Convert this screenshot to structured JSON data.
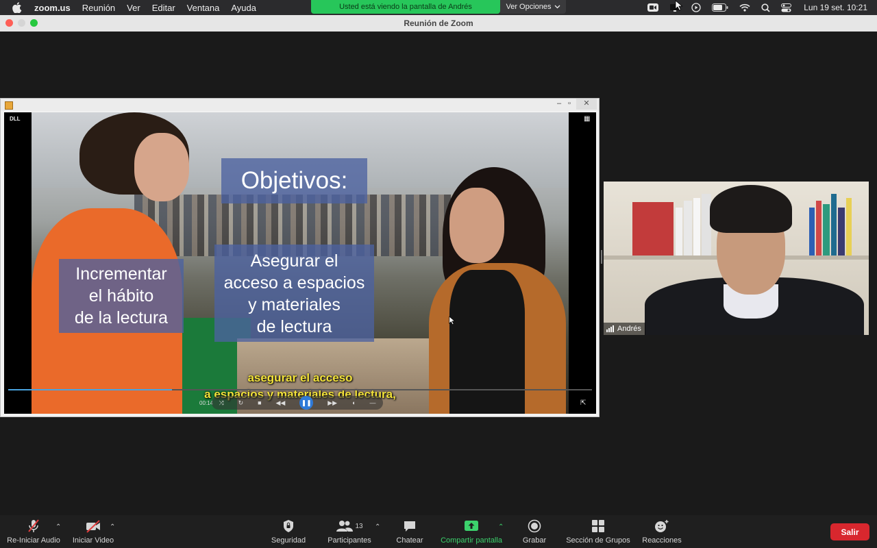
{
  "menubar": {
    "app_name": "zoom.us",
    "menus": [
      "Reunión",
      "Ver",
      "Editar",
      "Ventana",
      "Ayuda"
    ],
    "share_banner": "Usted está viendo la pantalla de Andrés",
    "view_options": "Ver Opciones",
    "clock": "Lun 19 set.  10:21"
  },
  "window": {
    "title": "Reunión de Zoom"
  },
  "shared_screen": {
    "corner_label": "DLL",
    "title_box": "Objetivos:",
    "left_box": [
      "Incrementar",
      "el hábito",
      "de la lectura"
    ],
    "mid_box": [
      "Asegurar el",
      "acceso a espacios",
      "y materiales",
      "de lectura"
    ],
    "subtitle_line1": "asegurar el acceso",
    "subtitle_line2": "a espacios y materiales de lectura,",
    "time": "00:14",
    "progress_fraction": 0.28
  },
  "participant": {
    "name": "Andrés"
  },
  "toolbar": {
    "audio_label": "Re-Iniciar Audio",
    "video_label": "Iniciar Video",
    "security_label": "Seguridad",
    "participants_label": "Participantes",
    "participants_count": "13",
    "chat_label": "Chatear",
    "share_label": "Compartir pantalla",
    "record_label": "Grabar",
    "breakout_label": "Sección de Grupos",
    "reactions_label": "Reacciones",
    "leave_label": "Salir"
  },
  "colors": {
    "share_green": "#27c65a",
    "leave_red": "#d8272e",
    "slide_box": "#4b62a0",
    "subtitle_yellow": "#f2e23a"
  }
}
